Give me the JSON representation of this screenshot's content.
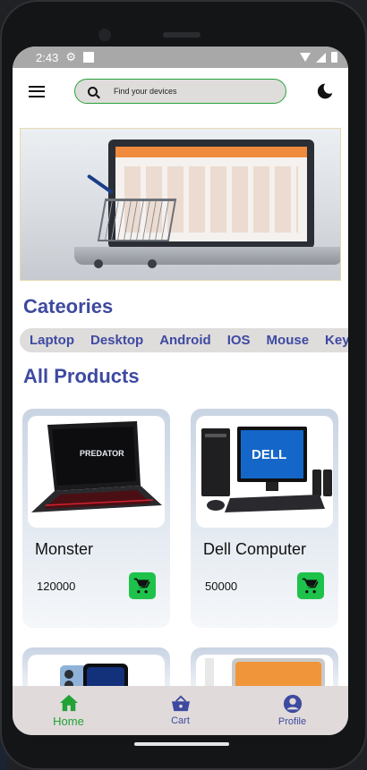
{
  "status_bar": {
    "time": "2:43"
  },
  "app_bar": {
    "menu_icon": "hamburger-menu-icon",
    "search_placeholder": "Find your devices",
    "theme_icon": "moon-icon"
  },
  "categories": {
    "title": "Cateories",
    "items": [
      "Laptop",
      "Desktop",
      "Android",
      "IOS",
      "Mouse",
      "Keyb"
    ]
  },
  "products": {
    "title": "All Products",
    "items": [
      {
        "name": "Monster",
        "price": "120000"
      },
      {
        "name": "Dell Computer",
        "price": "50000"
      }
    ]
  },
  "bottom_nav": {
    "items": [
      {
        "label": "Home",
        "icon": "home-icon",
        "active": true
      },
      {
        "label": "Cart",
        "icon": "basket-icon",
        "active": false
      },
      {
        "label": "Profile",
        "icon": "account-circle-icon",
        "active": false
      }
    ]
  },
  "colors": {
    "accent": "#3e4aa0",
    "active_nav": "#21a336",
    "cart_button": "#1ec24b",
    "search_border": "#27a33a"
  }
}
